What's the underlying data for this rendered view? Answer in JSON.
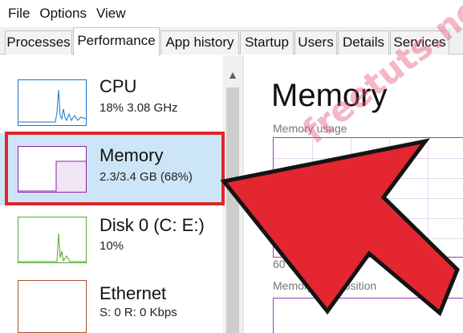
{
  "menu": [
    "File",
    "Options",
    "View"
  ],
  "tabs": [
    {
      "label": "Processes",
      "active": false
    },
    {
      "label": "Performance",
      "active": true
    },
    {
      "label": "App history",
      "active": false
    },
    {
      "label": "Startup",
      "active": false
    },
    {
      "label": "Users",
      "active": false
    },
    {
      "label": "Details",
      "active": false
    },
    {
      "label": "Services",
      "active": false
    }
  ],
  "resources": [
    {
      "name": "CPU",
      "detail": "18% 3.08 GHz",
      "color": "#1874cd",
      "selected": false
    },
    {
      "name": "Memory",
      "detail": "2.3/3.4 GB (68%)",
      "color": "#8b22a8",
      "selected": true
    },
    {
      "name": "Disk 0 (C: E:)",
      "detail": "10%",
      "color": "#4da82e",
      "selected": false
    },
    {
      "name": "Ethernet",
      "detail": "S: 0 R: 0 Kbps",
      "color": "#a7532a",
      "selected": false
    }
  ],
  "detail": {
    "title": "Memory",
    "usage_label": "Memory usage",
    "time_label": "60 se",
    "composition_label": "Memory composition"
  },
  "annotation": {
    "box_color": "#e0262b",
    "arrow_color": "#e32630",
    "watermark": "freetuts.net"
  }
}
